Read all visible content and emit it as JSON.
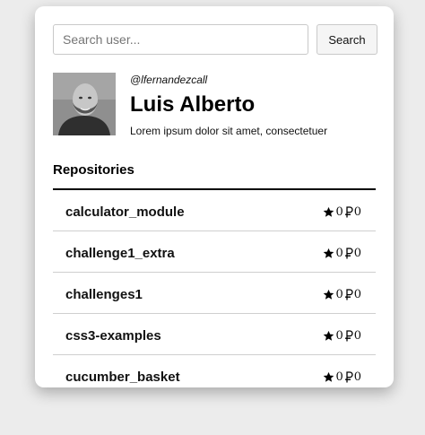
{
  "search": {
    "placeholder": "Search user...",
    "value": "",
    "button_label": "Search"
  },
  "profile": {
    "handle": "@lfernandezcall",
    "name": "Luis Alberto",
    "bio": "Lorem ipsum dolor sit amet, consectetuer"
  },
  "repositories": {
    "heading": "Repositories",
    "items": [
      {
        "name": "calculator_module",
        "stars": "0",
        "forks": "0"
      },
      {
        "name": "challenge1_extra",
        "stars": "0",
        "forks": "0"
      },
      {
        "name": "challenges1",
        "stars": "0",
        "forks": "0"
      },
      {
        "name": "css3-examples",
        "stars": "0",
        "forks": "0"
      },
      {
        "name": "cucumber_basket",
        "stars": "0",
        "forks": "0"
      }
    ]
  },
  "icons": {
    "star": "star-icon",
    "fork": "fork-icon"
  },
  "colors": {
    "background": "#ececec",
    "card": "#ffffff",
    "text": "#111111"
  }
}
